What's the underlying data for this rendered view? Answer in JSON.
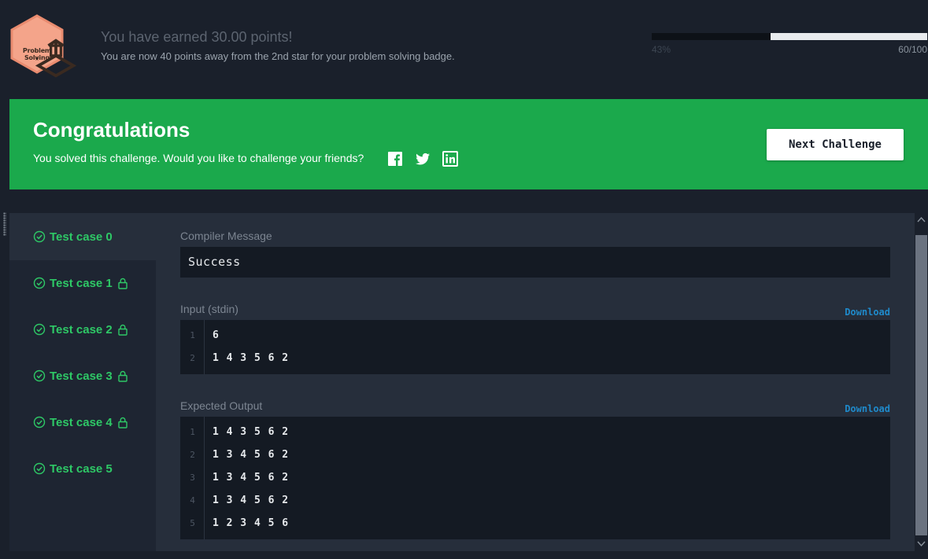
{
  "badge": {
    "label": "Problem Solving",
    "star": "★",
    "colors": {
      "hex_fill": "#f4a48a",
      "hex_border": "#e98b6f"
    }
  },
  "points": {
    "title": "You have earned 30.00 points!",
    "subtitle": "You are now 40 points away from the 2nd star for your problem solving badge."
  },
  "progress": {
    "percent_label": "43%",
    "fraction_label": "60/100",
    "fill_fraction": 0.57
  },
  "congrats": {
    "title": "Congratulations",
    "subtitle": "You solved this challenge. Would you like to challenge your friends?",
    "next_label": "Next Challenge",
    "social_icons": [
      "facebook-icon",
      "twitter-icon",
      "linkedin-icon"
    ]
  },
  "tabs": [
    {
      "label": "Test case 0",
      "locked": false,
      "active": true
    },
    {
      "label": "Test case 1",
      "locked": true,
      "active": false
    },
    {
      "label": "Test case 2",
      "locked": true,
      "active": false
    },
    {
      "label": "Test case 3",
      "locked": true,
      "active": false
    },
    {
      "label": "Test case 4",
      "locked": true,
      "active": false
    },
    {
      "label": "Test case 5",
      "locked": false,
      "active": false
    }
  ],
  "compiler": {
    "label": "Compiler Message",
    "message": "Success"
  },
  "input": {
    "label": "Input (stdin)",
    "download_label": "Download",
    "lines": [
      {
        "num": "1",
        "text": "6"
      },
      {
        "num": "2",
        "text": "1 4 3 5 6 2"
      }
    ]
  },
  "expected": {
    "label": "Expected Output",
    "download_label": "Download",
    "lines": [
      {
        "num": "1",
        "text": "1 4 3 5 6 2"
      },
      {
        "num": "2",
        "text": "1 3 4 5 6 2"
      },
      {
        "num": "3",
        "text": "1 3 4 5 6 2"
      },
      {
        "num": "4",
        "text": "1 3 4 5 6 2"
      },
      {
        "num": "5",
        "text": "1 2 3 4 5 6"
      }
    ]
  },
  "colors": {
    "success_green": "#2ec866",
    "banner_green": "#1ba94c",
    "link_blue": "#1f8acb",
    "background": "#1a202b"
  }
}
